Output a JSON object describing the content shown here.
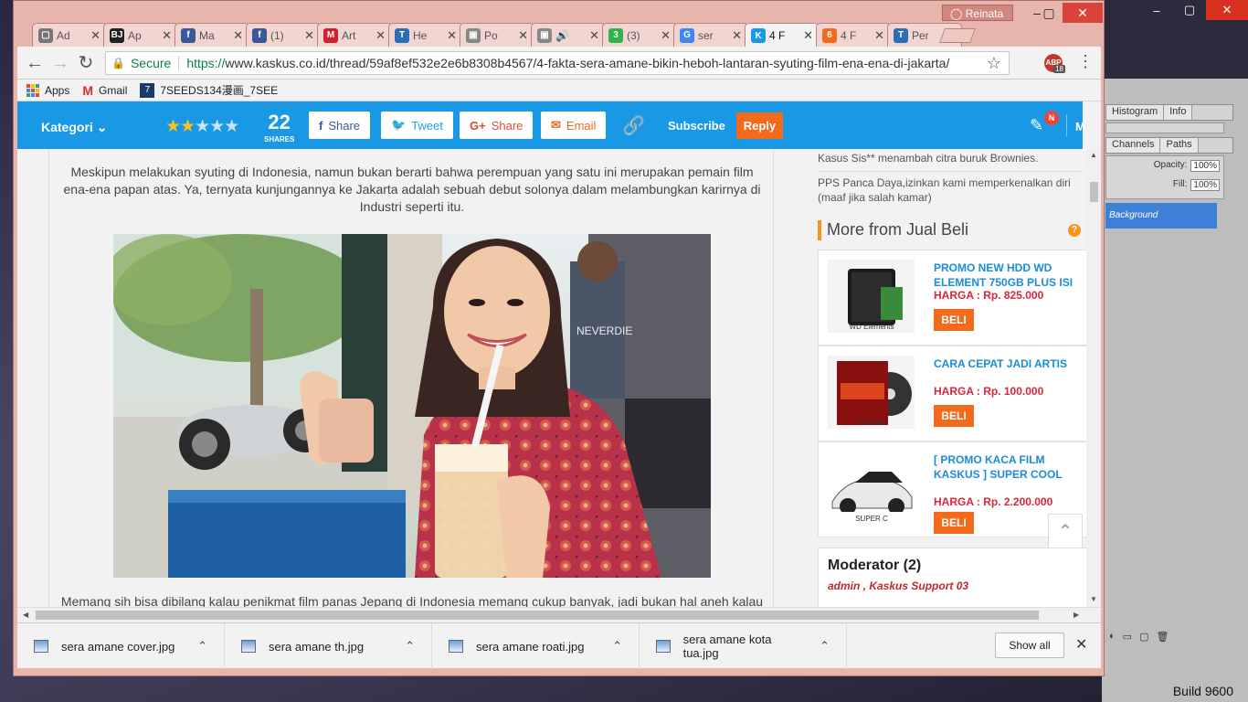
{
  "photoshop": {
    "panel_tabs1": [
      "Histogram",
      "Info"
    ],
    "panel_tabs2": [
      "Channels",
      "Paths"
    ],
    "opacity_label": "Opacity:",
    "opacity_value": "100%",
    "fill_label": "Fill:",
    "fill_value": "100%",
    "layer_name": "Background",
    "build": "Build 9600"
  },
  "window": {
    "profile_name": "Reinata",
    "tabs": [
      {
        "title": "Ad",
        "color": "#777",
        "glyph": "▢",
        "active": false
      },
      {
        "title": "Ap",
        "color": "#222",
        "glyph": "BJ",
        "active": false
      },
      {
        "title": "Ma",
        "color": "#3b5998",
        "glyph": "f",
        "active": false
      },
      {
        "title": "(1)",
        "color": "#3b5998",
        "glyph": "f",
        "active": false
      },
      {
        "title": "Art",
        "color": "#d0202b",
        "glyph": "M",
        "active": false
      },
      {
        "title": "He",
        "color": "#2a6fb5",
        "glyph": "T",
        "active": false
      },
      {
        "title": "Po",
        "color": "#888",
        "glyph": "▣",
        "active": false
      },
      {
        "title": "🔊",
        "color": "#888",
        "glyph": "▣",
        "active": false
      },
      {
        "title": "(3)",
        "color": "#2fb34a",
        "glyph": "3",
        "active": false
      },
      {
        "title": "ser",
        "color": "#4285f4",
        "glyph": "G",
        "active": false
      },
      {
        "title": "4 F",
        "color": "#1998e5",
        "glyph": "K",
        "active": true
      },
      {
        "title": "4 F",
        "color": "#f26b1d",
        "glyph": "6",
        "active": false
      },
      {
        "title": "Per",
        "color": "#2a6fb5",
        "glyph": "T",
        "active": false
      }
    ]
  },
  "omnibox": {
    "secure": "Secure",
    "url_scheme": "https://",
    "url_host": "www.kaskus.co.id",
    "url_path": "/thread/59af8ef532e2e6b8308b4567/4-fakta-sera-amane-bikin-heboh-lantaran-syuting-film-ena-ena-di-jakarta/",
    "ext_badge": "18"
  },
  "bookmarks": [
    "Apps",
    "Gmail",
    "7SEEDS134漫画_7SEE"
  ],
  "kaskus": {
    "kategori": "Kategori",
    "rating": 2,
    "shares_count": "22",
    "shares_label": "SHARES",
    "share_fb": "Share",
    "share_tw": "Tweet",
    "share_gp": "Share",
    "share_email": "Email",
    "subscribe": "Subscribe",
    "reply": "Reply",
    "notif": "N",
    "more": "M"
  },
  "article": {
    "para1": "Meskipun melakukan syuting di Indonesia, namun bukan berarti bahwa perempuan yang satu ini merupakan pemain film ena-ena papan atas. Ya, ternyata kunjungannya ke Jakarta adalah sebuah debut solonya dalam melambungkan karirnya di Industri seperti itu.",
    "para2": "Memang sih bisa dibilang kalau penikmat film panas Jepang di Indonesia memang cukup banyak, jadi bukan hal aneh kalau",
    "photo_shirt_text": "NEVERDIE"
  },
  "sidebar": {
    "item1": "Kasus Sis** menambah citra buruk Brownies.",
    "item2": "PPS Panca Daya,izinkan kami memperkenalkan diri (maaf jika salah kamar)",
    "more_title": "More from Jual Beli",
    "products": [
      {
        "name": "PROMO NEW HDD WD ELEMENT 750GB PLUS ISI",
        "price": "HARGA : Rp. 825.000",
        "buy": "BELI",
        "img_label": "WD Elements"
      },
      {
        "name": "CARA CEPAT JADI ARTIS",
        "price": "HARGA : Rp. 100.000",
        "buy": "BELI",
        "img_label": "Jadi Artis"
      },
      {
        "name": "[ PROMO KACA FILM KASKUS ] SUPER COOL",
        "price": "HARGA : Rp. 2.200.000",
        "buy": "BELI",
        "img_label": "SUPER C"
      }
    ],
    "moderator_title": "Moderator (2)",
    "moderator_users": "admin , Kaskus Support 03"
  },
  "downloads": {
    "files": [
      "sera amane cover.jpg",
      "sera amane th.jpg",
      "sera amane roati.jpg",
      "sera amane kota tua.jpg"
    ],
    "show_all": "Show all"
  }
}
